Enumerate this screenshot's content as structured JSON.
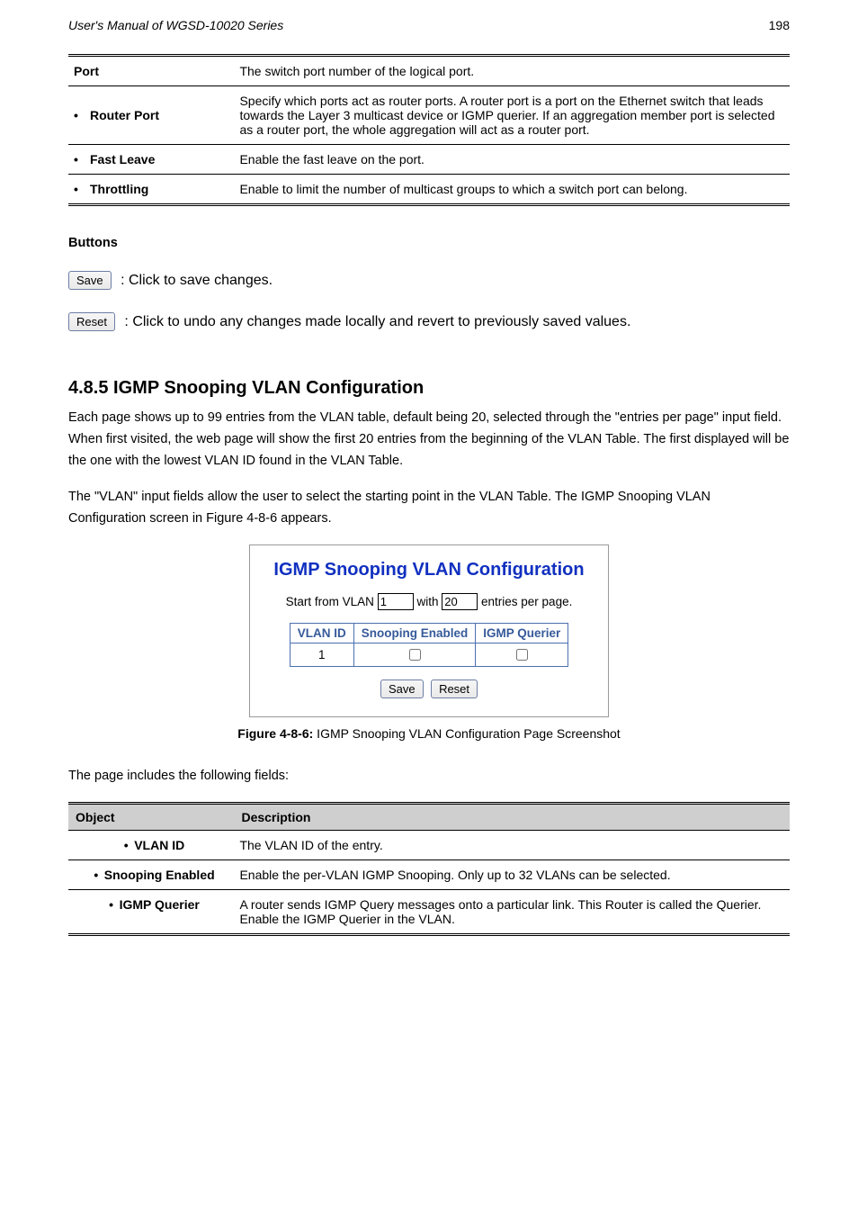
{
  "header_left": "User's Manual of WGSD-10020 Series",
  "page_number": "198",
  "top_table": {
    "header": {
      "port": "Port",
      "desc": "The switch port number of the logical port."
    },
    "rows": [
      {
        "label": "Router Port",
        "desc": "Specify which ports act as router ports. A router port is a port on the Ethernet switch that leads towards the Layer 3 multicast device or IGMP querier. If an aggregation member port is selected as a router port, the whole aggregation will act as a router port."
      },
      {
        "label": "Fast Leave",
        "desc": "Enable the fast leave on the port."
      },
      {
        "label": "Throttling",
        "desc": "Enable to limit the number of multicast groups to which a switch port can belong."
      }
    ]
  },
  "buttons": {
    "heading": "Buttons",
    "save_label": "Save",
    "save_desc": ": Click to save changes.",
    "reset_label": "Reset",
    "reset_desc": ": Click to undo any changes made locally and revert to previously saved values."
  },
  "section": {
    "heading": "4.8.5 IGMP Snooping VLAN Configuration",
    "p1_a": "Each page shows up to 99 entries from the VLAN table, default being 20, selected through the \"entries per page\" input field. When first visited, the web page will show the first 20 entries from the beginning of the VLAN Table. The first displayed will be the one with the lowest VLAN ID found in the VLAN Table.",
    "p2_a": "The \"VLAN\" input fields allow the user to select the starting point in the VLAN Table. The IGMP Snooping VLAN Configuration screen in ",
    "p2_fig": "Figure 4-8-6",
    "p2_b": " appears."
  },
  "screenshot": {
    "title": "IGMP Snooping VLAN Configuration",
    "line2_a": "Start from VLAN",
    "vlan_value": "1",
    "line2_b": "with",
    "entries_value": "20",
    "line2_c": "entries per page.",
    "cols": [
      "VLAN ID",
      "Snooping Enabled",
      "IGMP Querier"
    ],
    "row_vlan": "1",
    "save_label": "Save",
    "reset_label": "Reset"
  },
  "figure_caption_a": "Figure 4-8-6:",
  "figure_caption_b": " IGMP Snooping VLAN Configuration Page Screenshot",
  "page_includes": "The page includes the following fields:",
  "spec2": {
    "head_object": "Object",
    "head_desc": "Description",
    "rows": [
      {
        "label": "VLAN ID",
        "desc": "The VLAN ID of the entry."
      },
      {
        "label": "Snooping Enabled",
        "desc": "Enable the per-VLAN IGMP Snooping. Only up to 32 VLANs can be selected."
      },
      {
        "label": "IGMP Querier",
        "desc": "A router sends IGMP Query messages onto a particular link. This Router is called the Querier. Enable the IGMP Querier in the VLAN."
      }
    ]
  }
}
